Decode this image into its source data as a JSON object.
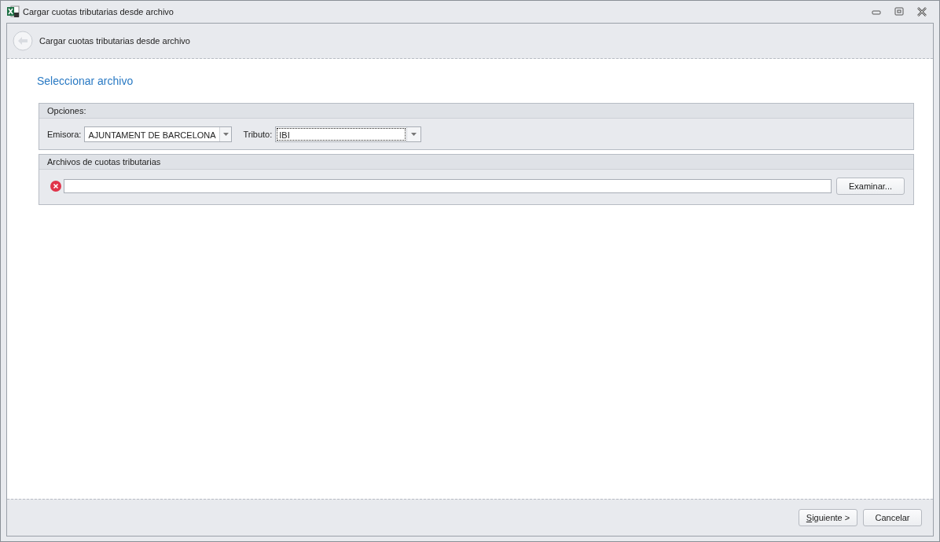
{
  "window": {
    "title": "Cargar cuotas tributarias desde archivo"
  },
  "header": {
    "title": "Cargar cuotas tributarias desde archivo"
  },
  "page_title": "Seleccionar archivo",
  "options_group": {
    "title": "Opciones:",
    "fields": [
      {
        "label": "Emisora:",
        "value": "AJUNTAMENT DE BARCELONA",
        "focused": false
      },
      {
        "label": "Tributo:",
        "value": "IBI",
        "focused": true
      }
    ]
  },
  "files_group": {
    "title": "Archivos de cuotas tributarias",
    "error": true,
    "browse_button": "Examinar..."
  },
  "buttons": [
    {
      "label": "Siguiente >",
      "mnemonic": true
    },
    {
      "label": "Cancelar",
      "mnemonic": false
    }
  ]
}
